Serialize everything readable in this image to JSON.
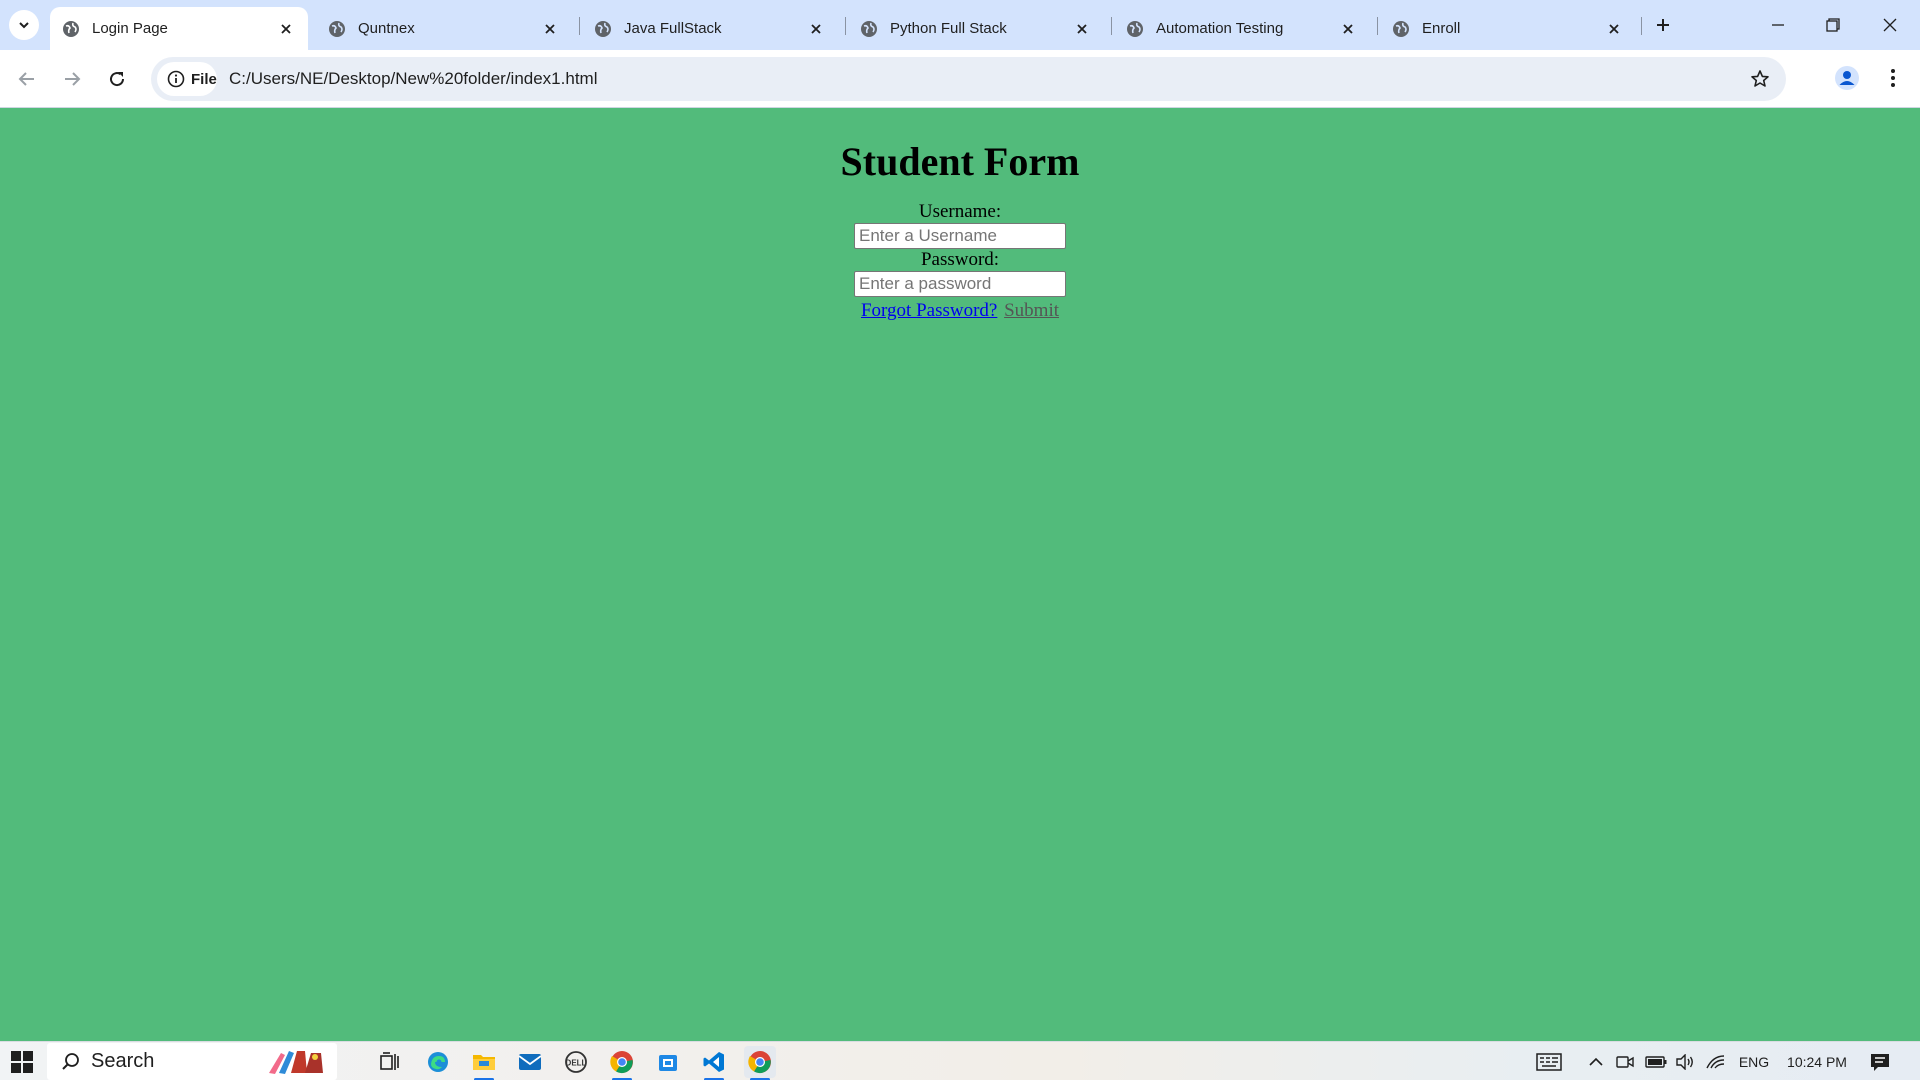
{
  "browser": {
    "tabs": [
      {
        "title": "Login Page",
        "active": true
      },
      {
        "title": "Quntnex",
        "active": false
      },
      {
        "title": "Java FullStack",
        "active": false
      },
      {
        "title": "Python Full Stack",
        "active": false
      },
      {
        "title": "Automation Testing",
        "active": false
      },
      {
        "title": "Enroll",
        "active": false
      }
    ],
    "site_chip_label": "File",
    "url": "C:/Users/NE/Desktop/New%20folder/index1.html"
  },
  "page": {
    "title": "Student Form",
    "username_label": "Username:",
    "username_placeholder": "Enter a Username",
    "username_value": "",
    "password_label": "Password:",
    "password_placeholder": "Enter a password",
    "password_value": "",
    "forgot_link": "Forgot Password?",
    "submit_link": "Submit",
    "background_color": "#52bb7b"
  },
  "taskbar": {
    "search_label": "Search",
    "language": "ENG",
    "time": "10:24 PM"
  },
  "colors": {
    "tabstrip": "#d3e3fd",
    "accent": "#1a73e8",
    "link": "#0000ee"
  }
}
